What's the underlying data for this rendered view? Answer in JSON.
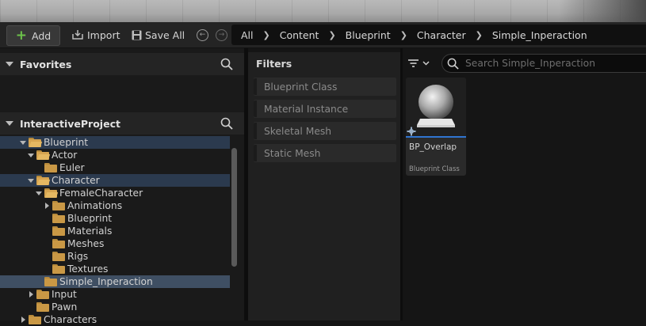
{
  "toolbar": {
    "add_label": "Add",
    "import_label": "Import",
    "save_all_label": "Save All"
  },
  "breadcrumb": [
    "All",
    "Content",
    "Blueprint",
    "Character",
    "Simple_Inperaction"
  ],
  "sidebar": {
    "favorites_label": "Favorites",
    "project_label": "InteractiveProject",
    "tree": [
      {
        "label": "Blueprint",
        "expanded": true,
        "state": "selected-parent"
      },
      {
        "label": "Actor",
        "expanded": true
      },
      {
        "label": "Euler",
        "expanded": false
      },
      {
        "label": "Character",
        "expanded": true,
        "state": "selected-parent"
      },
      {
        "label": "FemaleCharacter",
        "expanded": true
      },
      {
        "label": "Animations",
        "expanded": false
      },
      {
        "label": "Blueprint",
        "expanded": false
      },
      {
        "label": "Materials",
        "expanded": false
      },
      {
        "label": "Meshes",
        "expanded": false
      },
      {
        "label": "Rigs",
        "expanded": false
      },
      {
        "label": "Textures",
        "expanded": false
      },
      {
        "label": "Simple_Inperaction",
        "expanded": false,
        "state": "selected"
      },
      {
        "label": "Input",
        "expanded": false
      },
      {
        "label": "Pawn",
        "expanded": false
      },
      {
        "label": "Characters",
        "expanded": false
      }
    ]
  },
  "filters": {
    "title": "Filters",
    "items": [
      "Blueprint Class",
      "Material Instance",
      "Skeletal Mesh",
      "Static Mesh"
    ]
  },
  "search": {
    "placeholder": "Search Simple_Inperaction"
  },
  "assets": [
    {
      "name": "BP_Overlap",
      "type": "Blueprint Class"
    }
  ],
  "colors": {
    "accent_blue": "#2f74d0",
    "add_green": "#6cc24a",
    "folder": "#c99845",
    "selection": "#3f4f63"
  }
}
